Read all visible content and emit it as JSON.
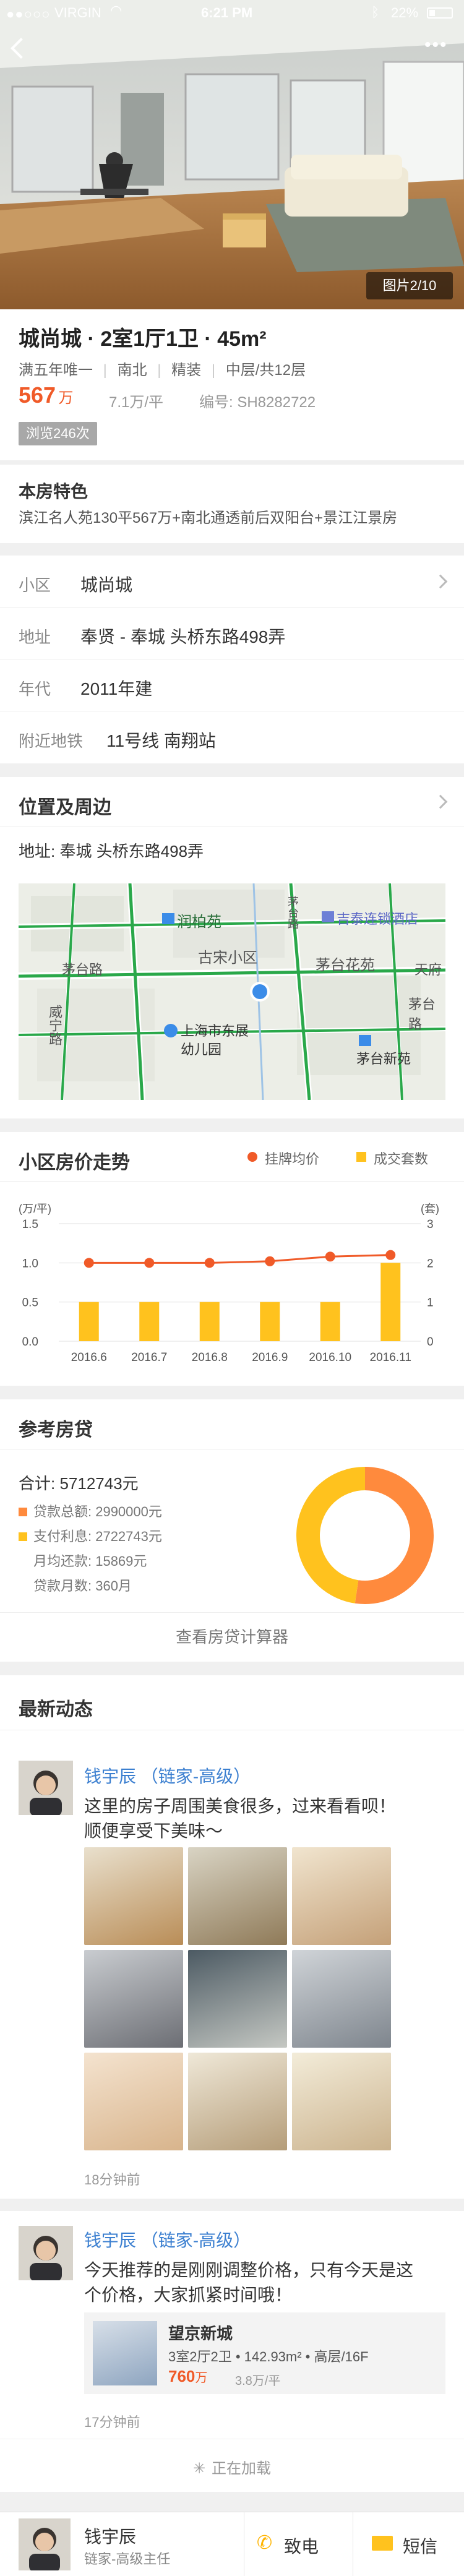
{
  "status_bar": {
    "carrier": "VIRGIN",
    "time": "6:21 PM",
    "battery": "22%"
  },
  "gallery": {
    "counter": "图片2/10"
  },
  "listing": {
    "title": "城尚城 · 2室1厅1卫 · 45m²",
    "tags": [
      "满五年唯一",
      "南北",
      "精装",
      "中层/共12层"
    ],
    "price": "567",
    "price_unit": "万",
    "unit_price": "7.1万/平",
    "code": "编号: SH8282722",
    "views": "浏览246次"
  },
  "features": {
    "heading": "本房特色",
    "text": "滨江名人苑130平567万+南北通透前后双阳台+景江江景房"
  },
  "details": [
    {
      "label": "小区",
      "value": "城尚城"
    },
    {
      "label": "地址",
      "value": "奉贤 - 奉城 头桥东路498弄"
    },
    {
      "label": "年代",
      "value": "2011年建"
    },
    {
      "label": "附近地铁",
      "value": "11号线  南翔站"
    }
  ],
  "location": {
    "heading": "位置及周边",
    "address": "地址: 奉城 头桥东路498弄",
    "map_labels": [
      "润柏苑",
      "吉泰连锁酒店",
      "古宋小区",
      "茅台花苑",
      "天府",
      "茅台路",
      "茅台路",
      "威宁路",
      "上海市东展幼儿园",
      "茅台新苑",
      "茅台路"
    ]
  },
  "price_trend": {
    "heading": "小区房价走势",
    "legend_line": "挂牌均价",
    "legend_bar": "成交套数",
    "left_unit": "(万/平)",
    "right_unit": "(套)"
  },
  "chart_data": {
    "type": "bar",
    "categories": [
      "2016.6",
      "2016.7",
      "2016.8",
      "2016.9",
      "2016.10",
      "2016.11"
    ],
    "series": [
      {
        "name": "挂牌均价",
        "type": "line",
        "axis": "left",
        "values": [
          1.0,
          1.0,
          1.0,
          1.02,
          1.08,
          1.1
        ],
        "color": "#f05a28"
      },
      {
        "name": "成交套数",
        "type": "bar",
        "axis": "right",
        "values": [
          1,
          1,
          1,
          1,
          1,
          2
        ],
        "color": "#ffc21e"
      }
    ],
    "left_ticks": [
      "1.5",
      "1.0",
      "0.5",
      "0.0"
    ],
    "right_ticks": [
      "3",
      "2",
      "1",
      "0"
    ],
    "ylim_left": [
      0,
      1.5
    ],
    "ylim_right": [
      0,
      3
    ]
  },
  "loan": {
    "heading": "参考房贷",
    "total": "合计: 5712743元",
    "principal": "贷款总额: 2990000元",
    "interest": "支付利息: 2722743元",
    "monthly": "月均还款: 15869元",
    "months": "贷款月数: 360月",
    "calculator": "查看房贷计算器",
    "donut": [
      {
        "name": "贷款总额",
        "value": 2990000,
        "color": "#ff8a3d"
      },
      {
        "name": "支付利息",
        "value": 2722743,
        "color": "#ffc21e"
      }
    ]
  },
  "news": {
    "heading": "最新动态",
    "posts": [
      {
        "author": "钱宇辰 （链家-高级）",
        "text1": "这里的房子周围美食很多，过来看看呗！",
        "text2": "顺便享受下美味～",
        "time": "18分钟前"
      },
      {
        "author": "钱宇辰 （链家-高级）",
        "text1": "今天推荐的是刚刚调整价格，只有今天是这",
        "text2": "个价格，大家抓紧时间哦！",
        "card_title": "望京新城",
        "card_info": "3室2厅2卫 • 142.93m² • 高层/16F",
        "card_price": "760",
        "card_price_unit": "万",
        "card_unit": "3.8万/平",
        "time": "17分钟前"
      }
    ],
    "loading": "正在加载"
  },
  "agent_bar": {
    "name": "钱宇辰",
    "title": "链家-高级主任",
    "call": "致电",
    "sms": "短信"
  }
}
